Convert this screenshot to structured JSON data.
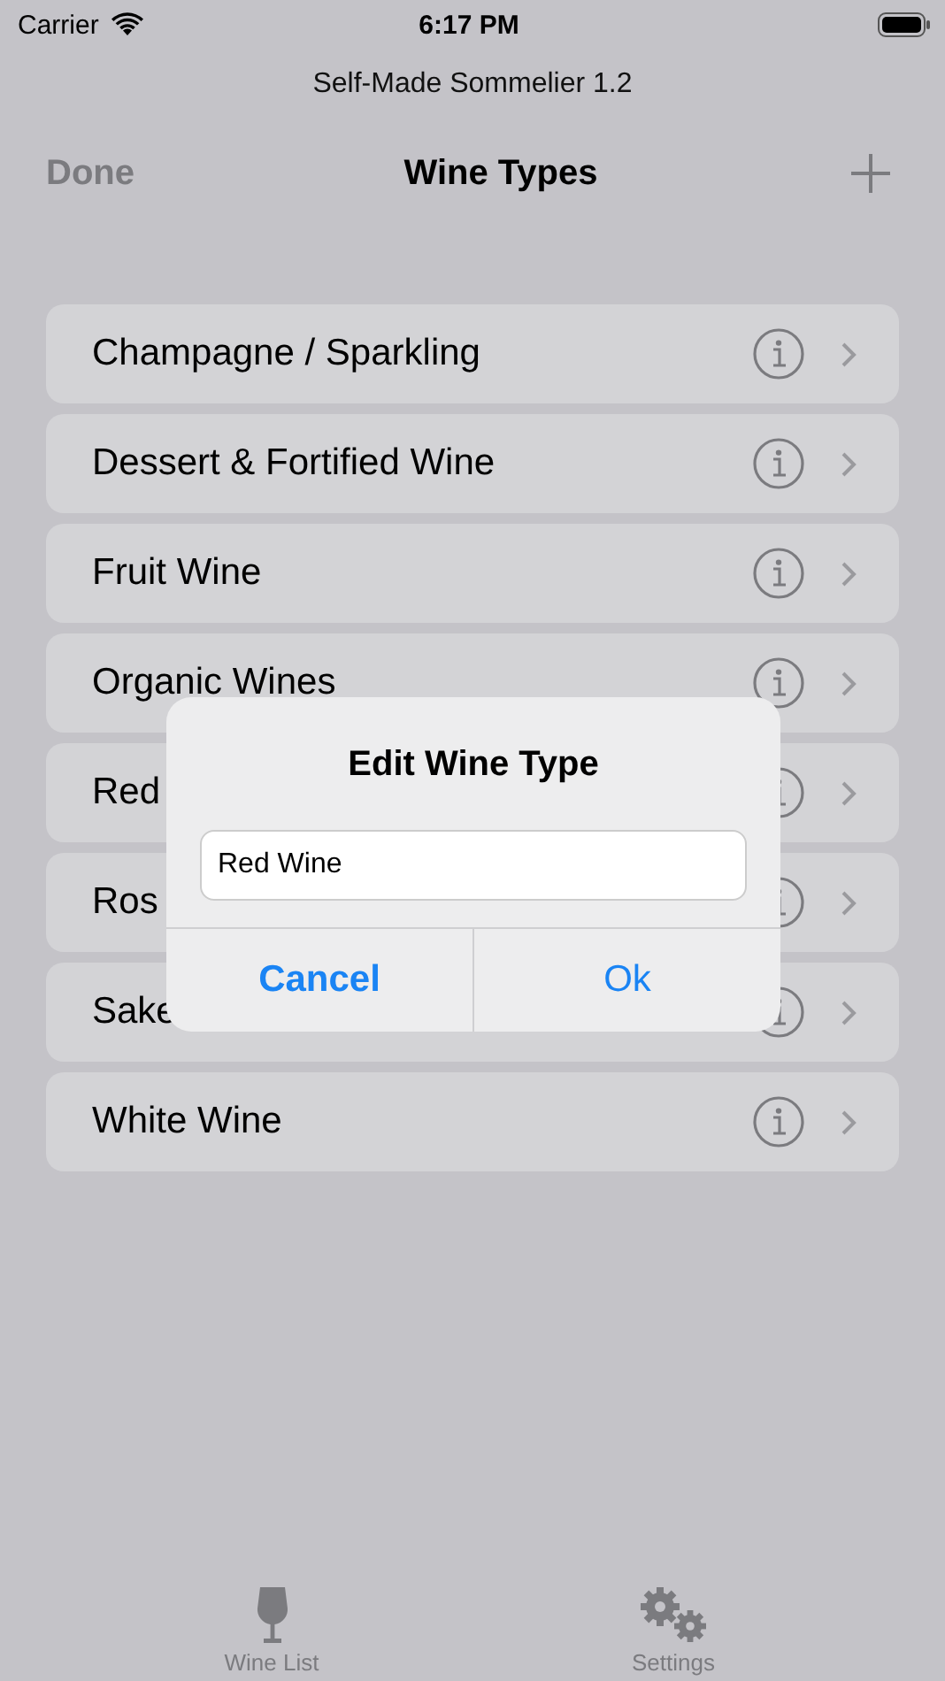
{
  "status_bar": {
    "carrier": "Carrier",
    "time": "6:17 PM"
  },
  "app_title": "Self-Made Sommelier 1.2",
  "nav": {
    "left": "Done",
    "title": "Wine Types"
  },
  "rows": [
    {
      "label": "Champagne / Sparkling"
    },
    {
      "label": "Dessert & Fortified Wine"
    },
    {
      "label": "Fruit Wine"
    },
    {
      "label": "Organic Wines"
    },
    {
      "label": "Red"
    },
    {
      "label": "Ros"
    },
    {
      "label": "Sake"
    },
    {
      "label": "White Wine"
    }
  ],
  "dialog": {
    "title": "Edit Wine Type",
    "value": "Red Wine",
    "buttons": [
      {
        "label": "Cancel",
        "kind": "cancel"
      },
      {
        "label": "Ok",
        "kind": "default"
      }
    ]
  },
  "tabs": [
    {
      "label": "Wine List",
      "kind": "glass"
    },
    {
      "label": "Settings",
      "kind": "gears"
    }
  ]
}
